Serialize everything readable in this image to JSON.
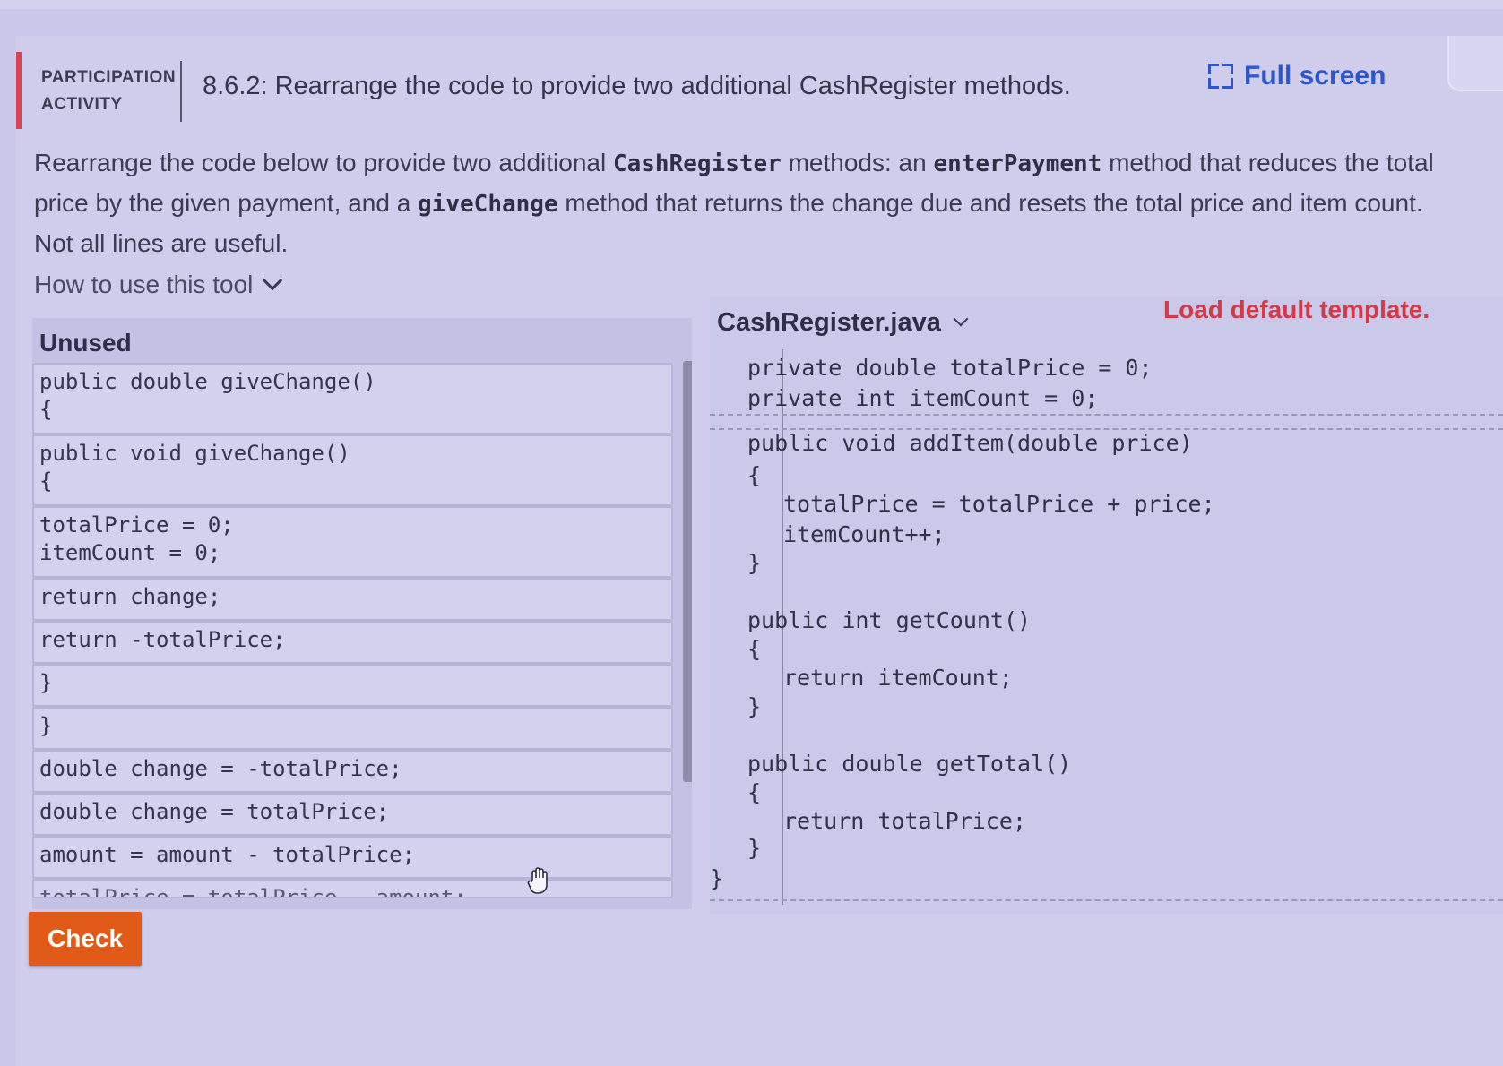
{
  "header": {
    "participation_label": "PARTICIPATION ACTIVITY",
    "activity_title": "8.6.2: Rearrange the code to provide two additional CashRegister methods.",
    "fullscreen_label": "Full screen"
  },
  "instructions": {
    "part1": "Rearrange the code below to provide two additional ",
    "code1": "CashRegister",
    "part2": " methods: an ",
    "code2": "enterPayment",
    "part3": " method that reduces the total price by the given payment, and a ",
    "code3": "giveChange",
    "part4": " method that returns the change due and resets the total price and item count. Not all lines are useful."
  },
  "howto": {
    "label": "How to use this tool"
  },
  "unused": {
    "title": "Unused",
    "blocks": [
      "public double giveChange()\n{",
      "public void giveChange()\n{",
      "totalPrice = 0;\nitemCount = 0;",
      "return change;",
      "return -totalPrice;",
      "}",
      "}",
      "double change = -totalPrice;",
      "double change = totalPrice;",
      "amount = amount - totalPrice;",
      "totalPrice = totalPrice - amount;"
    ]
  },
  "editor": {
    "filename": "CashRegister.java",
    "load_default": "Load default template.",
    "lines": [
      "private double totalPrice = 0;",
      "private int itemCount = 0;",
      "public void addItem(double price)",
      "{",
      "totalPrice = totalPrice + price;",
      "itemCount++;",
      "}",
      "public int getCount()",
      "{",
      "return itemCount;",
      "}",
      "public double getTotal()",
      "{",
      "return totalPrice;",
      "}",
      "}"
    ]
  },
  "check_button": {
    "label": "Check"
  },
  "colors": {
    "accent": "#d9434f",
    "link": "#2b57c9",
    "check": "#e15a18",
    "load_default": "#d33a45"
  }
}
